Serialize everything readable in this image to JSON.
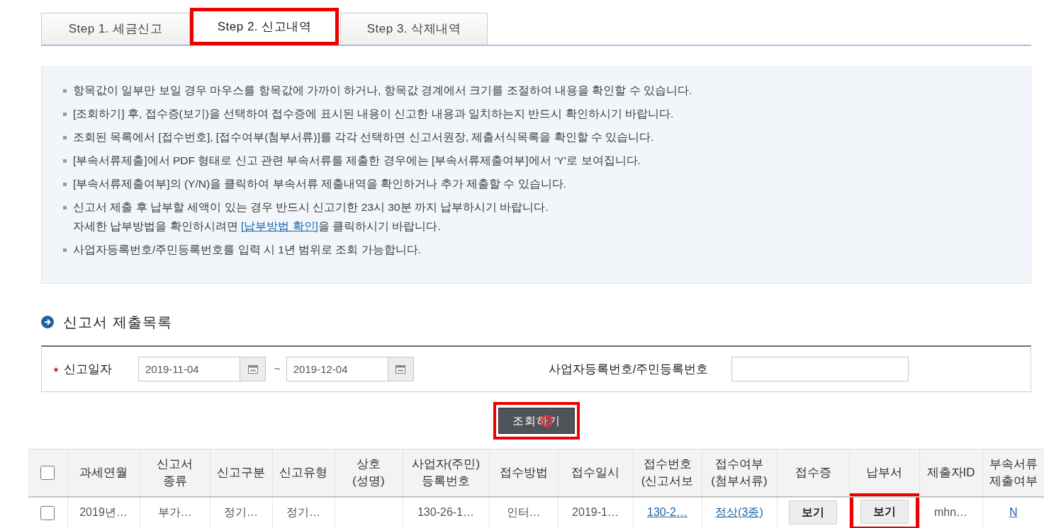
{
  "tabs": [
    {
      "label": "Step 1. 세금신고",
      "selected": false,
      "highlighted": false
    },
    {
      "label": "Step 2. 신고내역",
      "selected": true,
      "highlighted": true
    },
    {
      "label": "Step 3. 삭제내역",
      "selected": false,
      "highlighted": false
    }
  ],
  "notes": [
    {
      "text": "항목값이 일부만 보일 경우 마우스를 항목값에 가까이 하거나, 항목값 경계에서 크기를 조절하여 내용을 확인할 수 있습니다."
    },
    {
      "text": "[조회하기] 후, 접수증(보기)을 선택하여 접수증에 표시된 내용이 신고한 내용과 일치하는지 반드시 확인하시기 바랍니다."
    },
    {
      "text": "조회된 목록에서 [접수번호], [접수여부(첨부서류)]를 각각 선택하면 신고서원장, 제출서식목록을 확인할 수 있습니다."
    },
    {
      "text": "[부속서류제출]에서 PDF 형태로 신고 관련 부속서류를 제출한 경우에는 [부속서류제출여부]에서 ‘Y’로 보여집니다."
    },
    {
      "text": "[부속서류제출여부]의 (Y/N)을 클릭하여 부속서류 제출내역을 확인하거나 추가 제출할 수 있습니다."
    },
    {
      "text": "신고서 제출 후 납부할 세액이 있는 경우 반드시 신고기한 23시 30분 까지 납부하시기 바랍니다.",
      "detail": {
        "before": "자세한 납부방법을 확인하시려면 ",
        "link": "[납부방법 확인]",
        "after": "을 클릭하시기 바랍니다."
      }
    },
    {
      "text": "사업자등록번호/주민등록번호를 입력 시 1년 범위로 조회 가능합니다."
    }
  ],
  "section": {
    "title": "신고서 제출목록"
  },
  "search_form": {
    "date_label": "신고일자",
    "required": true,
    "date_from": "2019-11-04",
    "separator": "~",
    "date_to": "2019-12-04",
    "id_label": "사업자등록번호/주민등록번호"
  },
  "search_button": {
    "label": "조회하기",
    "highlighted": true,
    "clicked": true
  },
  "table": {
    "select_all": {
      "checked": false
    },
    "columns": [
      {
        "lines": [
          "과세연월"
        ]
      },
      {
        "lines": [
          "신고서",
          "종류"
        ]
      },
      {
        "lines": [
          "신고구분"
        ]
      },
      {
        "lines": [
          "신고유형"
        ]
      },
      {
        "lines": [
          "상호",
          "(성명)"
        ]
      },
      {
        "lines": [
          "사업자(주민)",
          "등록번호"
        ]
      },
      {
        "lines": [
          "접수방법"
        ]
      },
      {
        "lines": [
          "접수일시"
        ]
      },
      {
        "lines": [
          "접수번호",
          "(신고서보"
        ]
      },
      {
        "lines": [
          "접수여부",
          "(첨부서류)"
        ]
      },
      {
        "lines": [
          "접수증"
        ]
      },
      {
        "lines": [
          "납부서"
        ]
      },
      {
        "lines": [
          "제출자ID"
        ]
      },
      {
        "lines": [
          "부속서류",
          "제출여부"
        ]
      }
    ],
    "rows": [
      {
        "checked": false,
        "cells": [
          {
            "kind": "text",
            "text": "2019년…"
          },
          {
            "kind": "text",
            "text": "부가…"
          },
          {
            "kind": "text",
            "text": "정기…"
          },
          {
            "kind": "text",
            "text": "정기…"
          },
          {
            "kind": "blank"
          },
          {
            "kind": "text",
            "text": "130-26-1…"
          },
          {
            "kind": "text",
            "text": "인터…"
          },
          {
            "kind": "text",
            "text": "2019-1…"
          },
          {
            "kind": "link",
            "text": "130-2…"
          },
          {
            "kind": "link",
            "text": "정상(3종)"
          },
          {
            "kind": "button",
            "text": "보기",
            "highlighted": false
          },
          {
            "kind": "button",
            "text": "보기",
            "highlighted": true
          },
          {
            "kind": "text",
            "text": "mhn…"
          },
          {
            "kind": "link",
            "text": "N"
          }
        ]
      }
    ]
  }
}
